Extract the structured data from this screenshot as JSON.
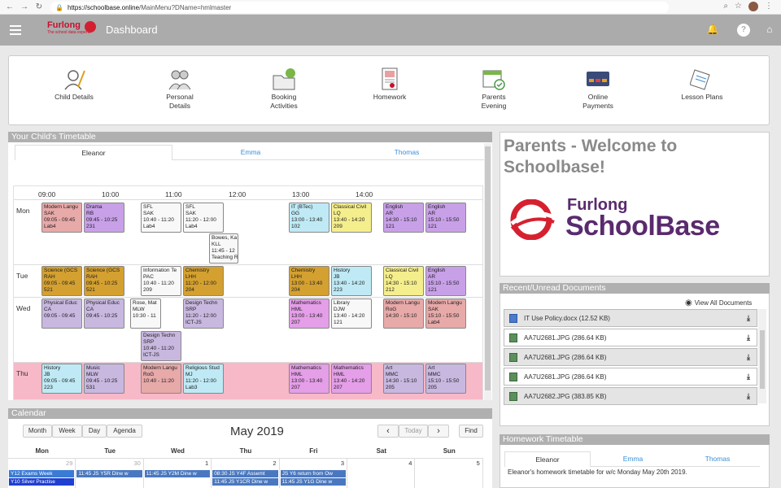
{
  "browser": {
    "url_host": "https://schoolbase.online",
    "url_path": "/MainMenu?DName=hmlmaster"
  },
  "header": {
    "brand": "Furlong",
    "tagline": "The school data experts",
    "title": "Dashboard"
  },
  "quick_links": [
    {
      "label": "Child Details",
      "icon": "child-details-icon"
    },
    {
      "label": "Personal\nDetails",
      "icon": "personal-details-icon"
    },
    {
      "label": "Booking\nActivities",
      "icon": "booking-activities-icon"
    },
    {
      "label": "Homework",
      "icon": "homework-icon"
    },
    {
      "label": "Parents\nEvening",
      "icon": "parents-evening-icon"
    },
    {
      "label": "Online\nPayments",
      "icon": "online-payments-icon"
    },
    {
      "label": "Lesson Plans",
      "icon": "lesson-plans-icon"
    }
  ],
  "timetable": {
    "title": "Your Child's Timetable",
    "tabs": [
      "Eleanor",
      "Emma",
      "Thomas"
    ],
    "times": [
      "09:00",
      "10:00",
      "11:00",
      "12:00",
      "13:00",
      "14:00"
    ],
    "days": [
      "Mon",
      "Tue",
      "Wed",
      "Thu"
    ],
    "events": [
      {
        "day": "Mon",
        "text": "Modern Langu\nSAK\n09:05 - 09:45\nLab4",
        "color": "#e8a9a9"
      },
      {
        "day": "Mon",
        "text": "Drama\nRB\n09:45 - 10:25\n231",
        "color": "#c8a0e8"
      },
      {
        "day": "Mon",
        "text": "SFL\nSAK\n10:40 - 11:20\nLab4",
        "color": "#f8f8f8"
      },
      {
        "day": "Mon",
        "text": "SFL\nSAK\n11:20 - 12:00\nLab4",
        "color": "#f8f8f8"
      },
      {
        "day": "Mon",
        "text": "Bowes, Ka\nKLL\n11:45 - 12\nTeaching R",
        "color": "#f8f8f8"
      },
      {
        "day": "Mon",
        "text": "IT (BTec)\nGG\n13:00 - 13:40\n102",
        "color": "#bfeaf5"
      },
      {
        "day": "Mon",
        "text": "Classical Civil\nLQ\n13:40 - 14:20\n209",
        "color": "#f5ee8c"
      },
      {
        "day": "Mon",
        "text": "English\nAR\n14:30 - 15:10\n121",
        "color": "#c8a0e8"
      },
      {
        "day": "Mon",
        "text": "English\nAR\n15:10 - 15:50\n121",
        "color": "#c8a0e8"
      },
      {
        "day": "Tue",
        "text": "Science (GCS\nRAH\n09:05 - 09:45\n521",
        "color": "#d4a030"
      },
      {
        "day": "Tue",
        "text": "Science (GCS\nRAH\n09:45 - 10:25\n521",
        "color": "#d4a030"
      },
      {
        "day": "Tue",
        "text": "Information Te\nPAC\n10:40 - 11:20\n209",
        "color": "#f8f8f8"
      },
      {
        "day": "Tue",
        "text": "Chemistry\nLHH\n11:20 - 12:00\n204",
        "color": "#d4a030"
      },
      {
        "day": "Tue",
        "text": "Chemistry\nLHH\n13:00 - 13:40\n204",
        "color": "#d4a030"
      },
      {
        "day": "Tue",
        "text": "History\nJB\n13:40 - 14:20\n223",
        "color": "#bfeaf5"
      },
      {
        "day": "Tue",
        "text": "Classical Civil\nLQ\n14:30 - 15:10\n212",
        "color": "#f5ee8c"
      },
      {
        "day": "Tue",
        "text": "English\nAR\n15:10 - 15:50\n121",
        "color": "#c8a0e8"
      },
      {
        "day": "Wed",
        "text": "Physical Educ\nCA\n09:05 - 09:45",
        "color": "#c8b8e0"
      },
      {
        "day": "Wed",
        "text": "Physical Educ\nCA\n09:45 - 10:25",
        "color": "#c8b8e0"
      },
      {
        "day": "Wed",
        "text": "Rose, Mat\nMLW\n10:30 - 11",
        "color": "#f8f8f8"
      },
      {
        "day": "Wed",
        "text": "Design Techn\nSRP\n11:20 - 12:00\nICT-JS",
        "color": "#c8b8e0"
      },
      {
        "day": "Wed",
        "text": "Design Techn\nSRP\n10:40 - 11:20\nICT-JS",
        "color": "#c8b8e0"
      },
      {
        "day": "Wed",
        "text": "Mathematics\nHML\n13:00 - 13:40\n207",
        "color": "#e59ee8"
      },
      {
        "day": "Wed",
        "text": "Library\nDJW\n13:40 - 14:20\n121",
        "color": "#f8f8f8"
      },
      {
        "day": "Wed",
        "text": "Modern Langu\nRoG\n14:30 - 15:10\n",
        "color": "#e8a9a9"
      },
      {
        "day": "Wed",
        "text": "Modern Langu\nSAK\n15:10 - 15:50\nLab4",
        "color": "#e8a9a9"
      },
      {
        "day": "Thu",
        "text": "History\nJB\n09:05 - 09:45\n223",
        "color": "#bfeaf5"
      },
      {
        "day": "Thu",
        "text": "Music\nMLW\n09:45 - 10:25\n531",
        "color": "#c8b8e0"
      },
      {
        "day": "Thu",
        "text": "Modern Langu\nRoG\n10:40 - 11:20\n",
        "color": "#e8a9a9"
      },
      {
        "day": "Thu",
        "text": "Religious Stud\nMJ\n11:20 - 12:00\nLab3",
        "color": "#bfeaf5"
      },
      {
        "day": "Thu",
        "text": "Mathematics\nHML\n13:00 - 13:40\n207",
        "color": "#e59ee8"
      },
      {
        "day": "Thu",
        "text": "Mathematics\nHML\n13:40 - 14:20\n207",
        "color": "#e59ee8"
      },
      {
        "day": "Thu",
        "text": "Art\nMMC\n14:30 - 15:10\n205",
        "color": "#c8b8e0"
      },
      {
        "day": "Thu",
        "text": "Art\nMMC\n15:10 - 15:50\n205",
        "color": "#c8b8e0"
      }
    ]
  },
  "welcome": {
    "heading": "Parents - Welcome to Schoolbase!",
    "logo_top": "Furlong",
    "logo_bottom": "SchoolBase"
  },
  "documents": {
    "title": "Recent/Unread Documents",
    "view_all": "View All Documents",
    "items": [
      {
        "name": "IT Use Policy.docx (12.52 KB)"
      },
      {
        "name": "AA7U2681.JPG (286.64 KB)"
      },
      {
        "name": "AA7U2681.JPG (286.64 KB)"
      },
      {
        "name": "AA7U2681.JPG (286.64 KB)"
      },
      {
        "name": "AA7U2682.JPG (383.85 KB)"
      }
    ]
  },
  "homework": {
    "title": "Homework Timetable",
    "tabs": [
      "Eleanor",
      "Emma",
      "Thomas"
    ],
    "text": "Eleanor's homework timetable for w/c Monday May 20th 2019."
  },
  "calendar": {
    "title": "Calendar",
    "views": [
      "Month",
      "Week",
      "Day",
      "Agenda"
    ],
    "month": "May 2019",
    "prev": "‹",
    "today": "Today",
    "next": "›",
    "find": "Find",
    "weekdays": [
      "Mon",
      "Tue",
      "Wed",
      "Thu",
      "Fri",
      "Sat",
      "Sun"
    ],
    "dates": [
      "29",
      "30",
      "1",
      "2",
      "3",
      "4",
      "5"
    ],
    "events": [
      {
        "text": "Y12 Exams Week",
        "color": "#3a7bd5"
      },
      {
        "text": "Y10 Silver Practise",
        "color": "#1f3fd0"
      },
      {
        "text": "11:45 JS Y5R Dine w",
        "color": "#4a78c0"
      },
      {
        "text": "11:45 JS Y2M Dine w",
        "color": "#4a78c0"
      },
      {
        "text": "08:30 JS Y4F Assemt",
        "color": "#4a78c0"
      },
      {
        "text": "11:45 JS Y1CR Dine w",
        "color": "#4a78c0"
      },
      {
        "text": "JS Y6 return from Ow",
        "color": "#4a78c0"
      },
      {
        "text": "11:45 JS Y1G Dine w",
        "color": "#4a78c0"
      }
    ]
  }
}
